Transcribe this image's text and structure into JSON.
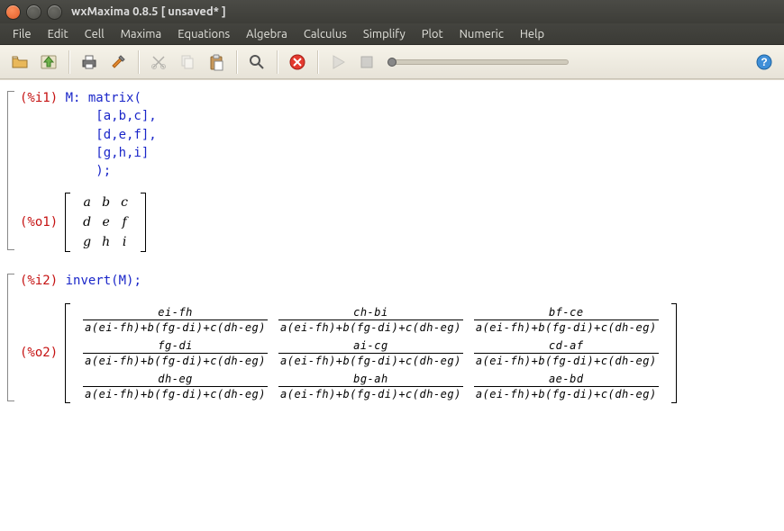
{
  "window": {
    "title": "wxMaxima 0.8.5 [ unsaved* ]"
  },
  "menu": {
    "items": [
      "File",
      "Edit",
      "Cell",
      "Maxima",
      "Equations",
      "Algebra",
      "Calculus",
      "Simplify",
      "Plot",
      "Numeric",
      "Help"
    ]
  },
  "toolbar": {
    "icons": [
      "open-icon",
      "save-icon",
      "print-icon",
      "prefs-icon",
      "cut-icon",
      "copy-icon",
      "paste-icon",
      "find-icon",
      "stop-icon",
      "play-icon",
      "stop2-icon"
    ]
  },
  "cells": [
    {
      "in_label": "(%i1)",
      "code_lines": [
        "M: matrix(",
        "    [a,b,c],",
        "    [d,e,f],",
        "    [g,h,i]",
        "    );"
      ],
      "out_label": "(%o1)",
      "matrix": [
        [
          "a",
          "b",
          "c"
        ],
        [
          "d",
          "e",
          "f"
        ],
        [
          "g",
          "h",
          "i"
        ]
      ]
    },
    {
      "in_label": "(%i2)",
      "code_lines": [
        "invert(M);"
      ],
      "out_label": "(%o2)",
      "det": "a(ei-fh)+b(fg-di)+c(dh-eg)",
      "numerators": [
        [
          "ei-fh",
          "ch-bi",
          "bf-ce"
        ],
        [
          "fg-di",
          "ai-cg",
          "cd-af"
        ],
        [
          "dh-eg",
          "bg-ah",
          "ae-bd"
        ]
      ]
    }
  ]
}
